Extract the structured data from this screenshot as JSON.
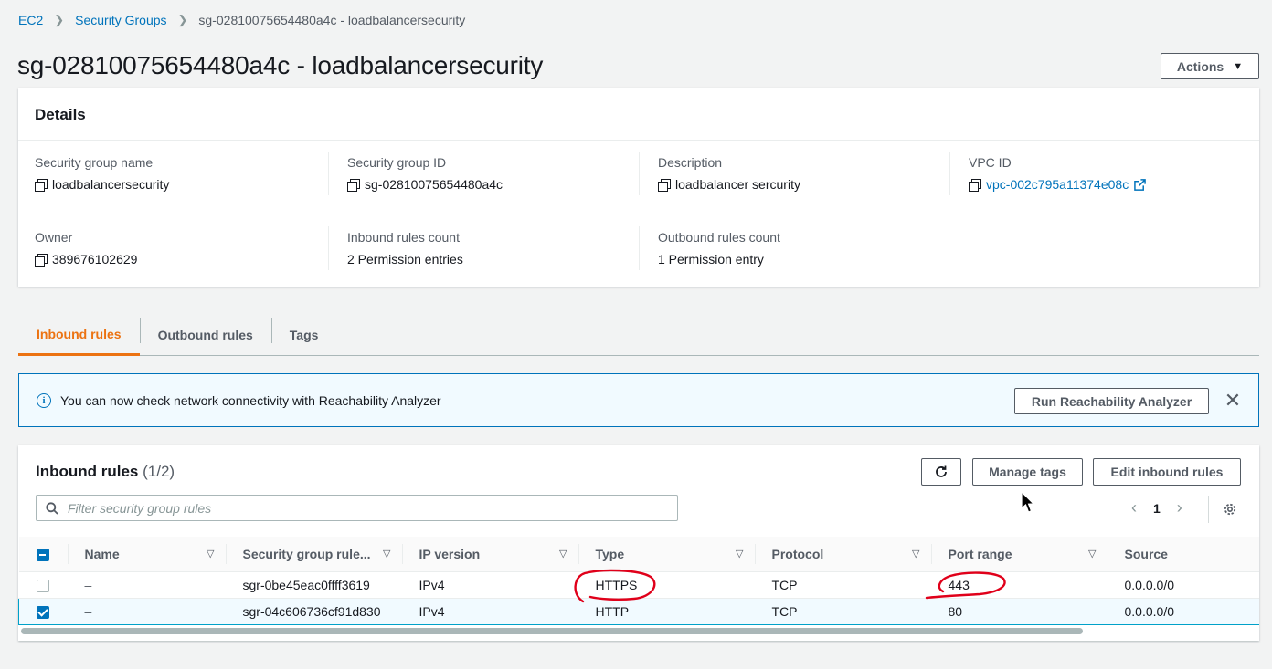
{
  "breadcrumb": {
    "root": "EC2",
    "section": "Security Groups",
    "current": "sg-02810075654480a4c - loadbalancersecurity"
  },
  "page_title": "sg-02810075654480a4c - loadbalancersecurity",
  "actions_label": "Actions",
  "details": {
    "title": "Details",
    "fields": {
      "name_label": "Security group name",
      "name_value": "loadbalancersecurity",
      "id_label": "Security group ID",
      "id_value": "sg-02810075654480a4c",
      "desc_label": "Description",
      "desc_value": "loadbalancer sercurity",
      "vpc_label": "VPC ID",
      "vpc_value": "vpc-002c795a11374e08c",
      "owner_label": "Owner",
      "owner_value": "389676102629",
      "inbound_label": "Inbound rules count",
      "inbound_value": "2 Permission entries",
      "outbound_label": "Outbound rules count",
      "outbound_value": "1 Permission entry"
    }
  },
  "tabs": [
    {
      "label": "Inbound rules",
      "active": true
    },
    {
      "label": "Outbound rules",
      "active": false
    },
    {
      "label": "Tags",
      "active": false
    }
  ],
  "banner": {
    "text": "You can now check network connectivity with Reachability Analyzer",
    "button": "Run Reachability Analyzer"
  },
  "rules": {
    "title": "Inbound rules",
    "count": "(1/2)",
    "manage_tags": "Manage tags",
    "edit_rules": "Edit inbound rules",
    "filter_placeholder": "Filter security group rules",
    "page": "1",
    "columns": [
      "Name",
      "Security group rule...",
      "IP version",
      "Type",
      "Protocol",
      "Port range",
      "Source"
    ],
    "rows": [
      {
        "selected": false,
        "name": "–",
        "rule_id": "sgr-0be45eac0ffff3619",
        "ip_version": "IPv4",
        "type": "HTTPS",
        "protocol": "TCP",
        "port_range": "443",
        "source": "0.0.0.0/0"
      },
      {
        "selected": true,
        "name": "–",
        "rule_id": "sgr-04c606736cf91d830",
        "ip_version": "IPv4",
        "type": "HTTP",
        "protocol": "TCP",
        "port_range": "80",
        "source": "0.0.0.0/0"
      }
    ]
  },
  "colors": {
    "link": "#0073bb",
    "tab_active": "#ec7211",
    "annotation": "#e0001a"
  },
  "icons": [
    "chevron-right-icon",
    "copy-icon",
    "external-link-icon",
    "info-icon",
    "close-icon",
    "refresh-icon",
    "search-icon",
    "settings-icon",
    "sort-icon",
    "pointer-cursor-icon"
  ]
}
